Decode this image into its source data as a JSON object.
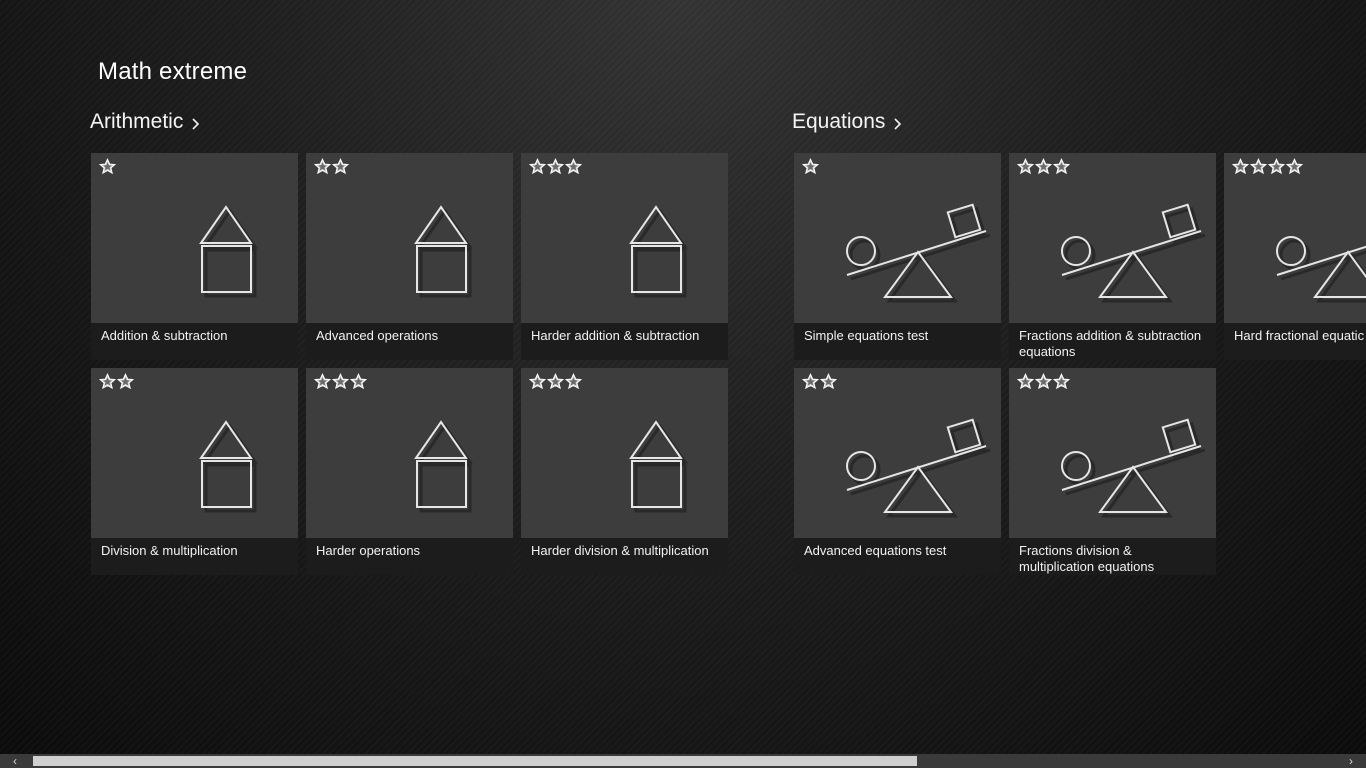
{
  "app_title": "Math extreme",
  "groups": [
    {
      "header": "Arithmetic",
      "tiles": [
        {
          "label": "Addition & subtraction",
          "stars": 1,
          "icon": "house-icon"
        },
        {
          "label": "Advanced operations",
          "stars": 2,
          "icon": "house-icon"
        },
        {
          "label": "Harder addition & subtraction",
          "stars": 3,
          "icon": "house-icon"
        },
        {
          "label": "Division & multiplication",
          "stars": 2,
          "icon": "house-icon"
        },
        {
          "label": "Harder operations",
          "stars": 3,
          "icon": "house-icon"
        },
        {
          "label": "Harder division & multiplication",
          "stars": 3,
          "icon": "house-icon"
        }
      ]
    },
    {
      "header": "Equations",
      "tiles": [
        {
          "label": "Simple equations test",
          "stars": 1,
          "icon": "seesaw-icon"
        },
        {
          "label": "Fractions addition & subtraction equations",
          "stars": 3,
          "icon": "seesaw-icon"
        },
        {
          "label": "Hard fractional equatic",
          "stars": 4,
          "icon": "seesaw-icon"
        },
        {
          "label": "Advanced equations test",
          "stars": 2,
          "icon": "seesaw-icon"
        },
        {
          "label": "Fractions division & multiplication equations",
          "stars": 3,
          "icon": "seesaw-icon"
        }
      ]
    }
  ],
  "scrollbar": {
    "left_arrow": "‹",
    "right_arrow": "›",
    "position": 0.0,
    "visible_fraction": 0.65
  },
  "colors": {
    "tile_bg": "#3d3d3d",
    "caption_bg": "#1c1c1c",
    "text": "#f2f2f2"
  }
}
